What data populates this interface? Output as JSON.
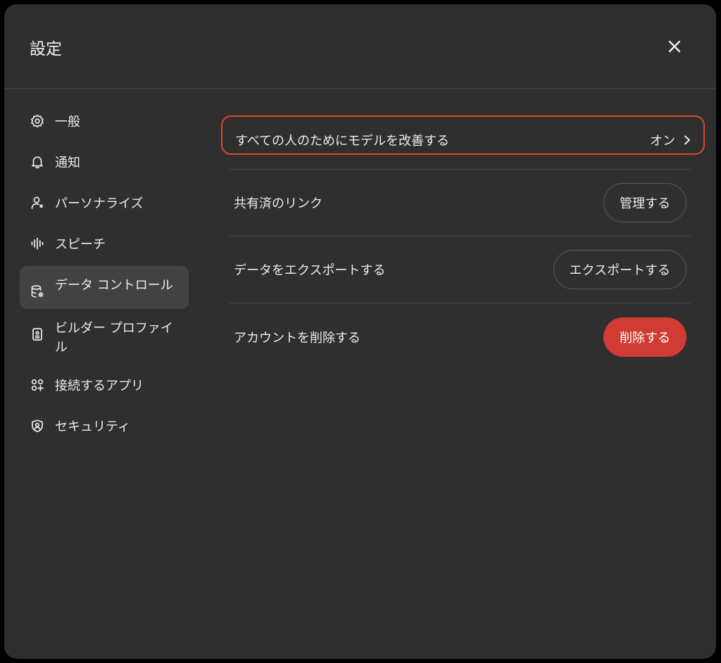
{
  "dialog": {
    "title": "設定",
    "close_icon": "close-icon"
  },
  "sidebar": {
    "items": [
      {
        "label": "一般",
        "icon": "gear-icon",
        "active": false
      },
      {
        "label": "通知",
        "icon": "bell-icon",
        "active": false
      },
      {
        "label": "パーソナライズ",
        "icon": "person-icon",
        "active": false
      },
      {
        "label": "スピーチ",
        "icon": "waveform-icon",
        "active": false
      },
      {
        "label": "データ コントロール",
        "icon": "database-gear-icon",
        "active": true
      },
      {
        "label": "ビルダー プロファイル",
        "icon": "id-card-icon",
        "active": false
      },
      {
        "label": "接続するアプリ",
        "icon": "apps-icon",
        "active": false
      },
      {
        "label": "セキュリティ",
        "icon": "shield-icon",
        "active": false
      }
    ]
  },
  "content": {
    "improve_model": {
      "label": "すべての人のためにモデルを改善する",
      "value": "オン",
      "highlight_color": "#e0442b"
    },
    "shared_links": {
      "label": "共有済のリンク",
      "button": "管理する"
    },
    "export_data": {
      "label": "データをエクスポートする",
      "button": "エクスポートする"
    },
    "delete_account": {
      "label": "アカウントを削除する",
      "button": "削除する",
      "button_color": "#d03b34"
    }
  }
}
